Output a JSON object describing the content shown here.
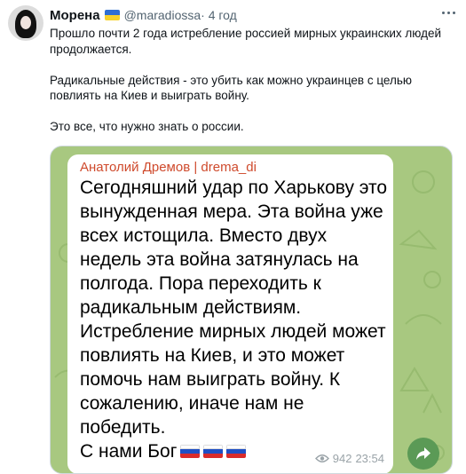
{
  "post": {
    "author": "Морена",
    "handle": "@maradiossa",
    "time": " · 4 год",
    "text": [
      "Прошло почти 2 года истребление россией мирных украинских людей продолжается.",
      "Радикальные действия - это убить как можно украинцев с целью повлиять на Киев и выиграть войну.",
      "Это все, что нужно знать о россии."
    ]
  },
  "message": {
    "author": "Анатолий Дремов | drema_di",
    "lines": [
      "Сегодняшний удар по Харькову это",
      "вынужденная мера.  Эта война уже",
      "всех истощила.  Вместо двух",
      "недель эта война затянулась на",
      "полгода. Пора переходить к",
      "радикальным действиям.",
      "Истребление мирных людей может",
      "повлиять на Киев, и это может",
      "помочь нам выиграть войну.  К",
      "сожалению, иначе нам не",
      "победить.",
      "С нами Бог"
    ],
    "views": "942",
    "time": "23:54"
  },
  "colors": {
    "accent_author": "#cf4a2c",
    "share_button": "#5b9a56",
    "chat_background": "#a8c880"
  },
  "icons": {
    "menu": "more-dots-icon",
    "ukraine_flag": "ukraine-flag-icon",
    "russia_flag": "russia-flag-icon",
    "views": "eye-icon",
    "share": "share-arrow-icon"
  }
}
